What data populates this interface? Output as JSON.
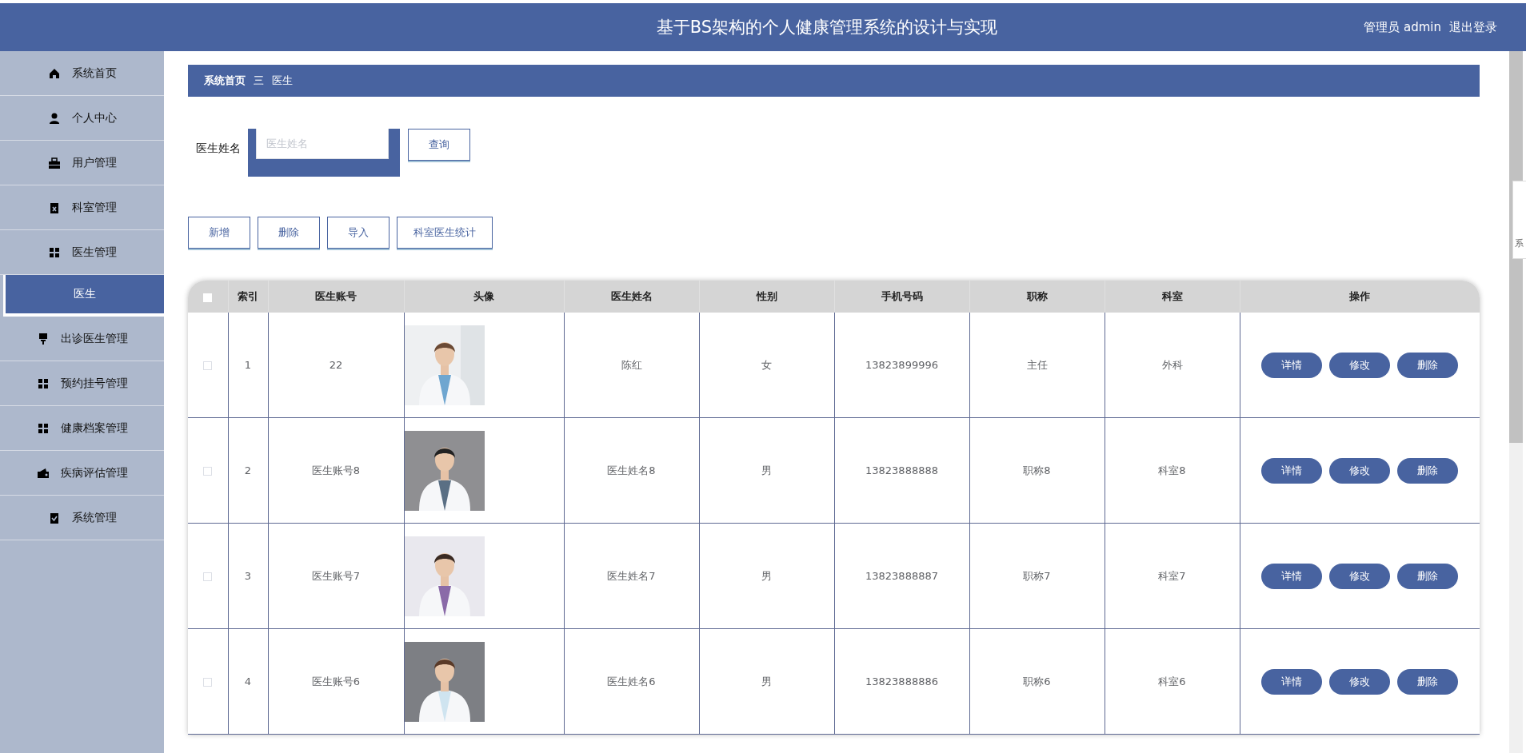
{
  "header": {
    "title": "基于BS架构的个人健康管理系统的设计与实现",
    "user": "管理员 admin",
    "logout": "退出登录"
  },
  "sidebar": {
    "items": [
      {
        "label": "系统首页",
        "kind": "menu",
        "selected": false
      },
      {
        "label": "个人中心",
        "kind": "menu",
        "selected": false
      },
      {
        "label": "用户管理",
        "kind": "menu",
        "selected": false
      },
      {
        "label": "科室管理",
        "kind": "menu",
        "selected": false
      },
      {
        "label": "医生管理",
        "kind": "menu",
        "selected": false
      },
      {
        "label": "医生",
        "kind": "submenu",
        "selected": true
      },
      {
        "label": "出诊医生管理",
        "kind": "menu",
        "selected": false
      },
      {
        "label": "预约挂号管理",
        "kind": "menu",
        "selected": false
      },
      {
        "label": "健康档案管理",
        "kind": "menu",
        "selected": false
      },
      {
        "label": "疾病评估管理",
        "kind": "menu",
        "selected": false
      },
      {
        "label": "系统管理",
        "kind": "menu",
        "selected": false
      }
    ]
  },
  "breadcrumb": {
    "items": [
      "系统首页",
      "医生"
    ],
    "separator": "三"
  },
  "search": {
    "label": "医生姓名",
    "placeholder": "医生姓名",
    "button": "查询"
  },
  "actions": [
    "新增",
    "删除",
    "导入",
    "科室医生统计"
  ],
  "table": {
    "all_checked": false,
    "columns": [
      "索引",
      "医生账号",
      "头像",
      "医生姓名",
      "性别",
      "手机号码",
      "职称",
      "科室",
      "操作"
    ],
    "rows": [
      {
        "checked": false,
        "cells": [
          "1",
          "22",
          {
            "kind": "picture"
          },
          "陈红",
          "女",
          "13823899996",
          "主任",
          "外科"
        ],
        "buttons": [
          "详情",
          "修改",
          "删除"
        ]
      },
      {
        "checked": false,
        "cells": [
          "2",
          "医生账号8",
          {
            "kind": "picture"
          },
          "医生姓名8",
          "男",
          "13823888888",
          "职称8",
          "科室8"
        ],
        "buttons": [
          "详情",
          "修改",
          "删除"
        ]
      },
      {
        "checked": false,
        "cells": [
          "3",
          "医生账号7",
          {
            "kind": "picture"
          },
          "医生姓名7",
          "男",
          "13823888887",
          "职称7",
          "科室7"
        ],
        "buttons": [
          "详情",
          "修改",
          "删除"
        ]
      },
      {
        "checked": false,
        "cells": [
          "4",
          "医生账号6",
          {
            "kind": "picture"
          },
          "医生姓名6",
          "男",
          "13823888886",
          "职称6",
          "科室6"
        ],
        "buttons": [
          "详情",
          "修改",
          "删除"
        ]
      }
    ]
  },
  "popup": {
    "text": "系"
  }
}
